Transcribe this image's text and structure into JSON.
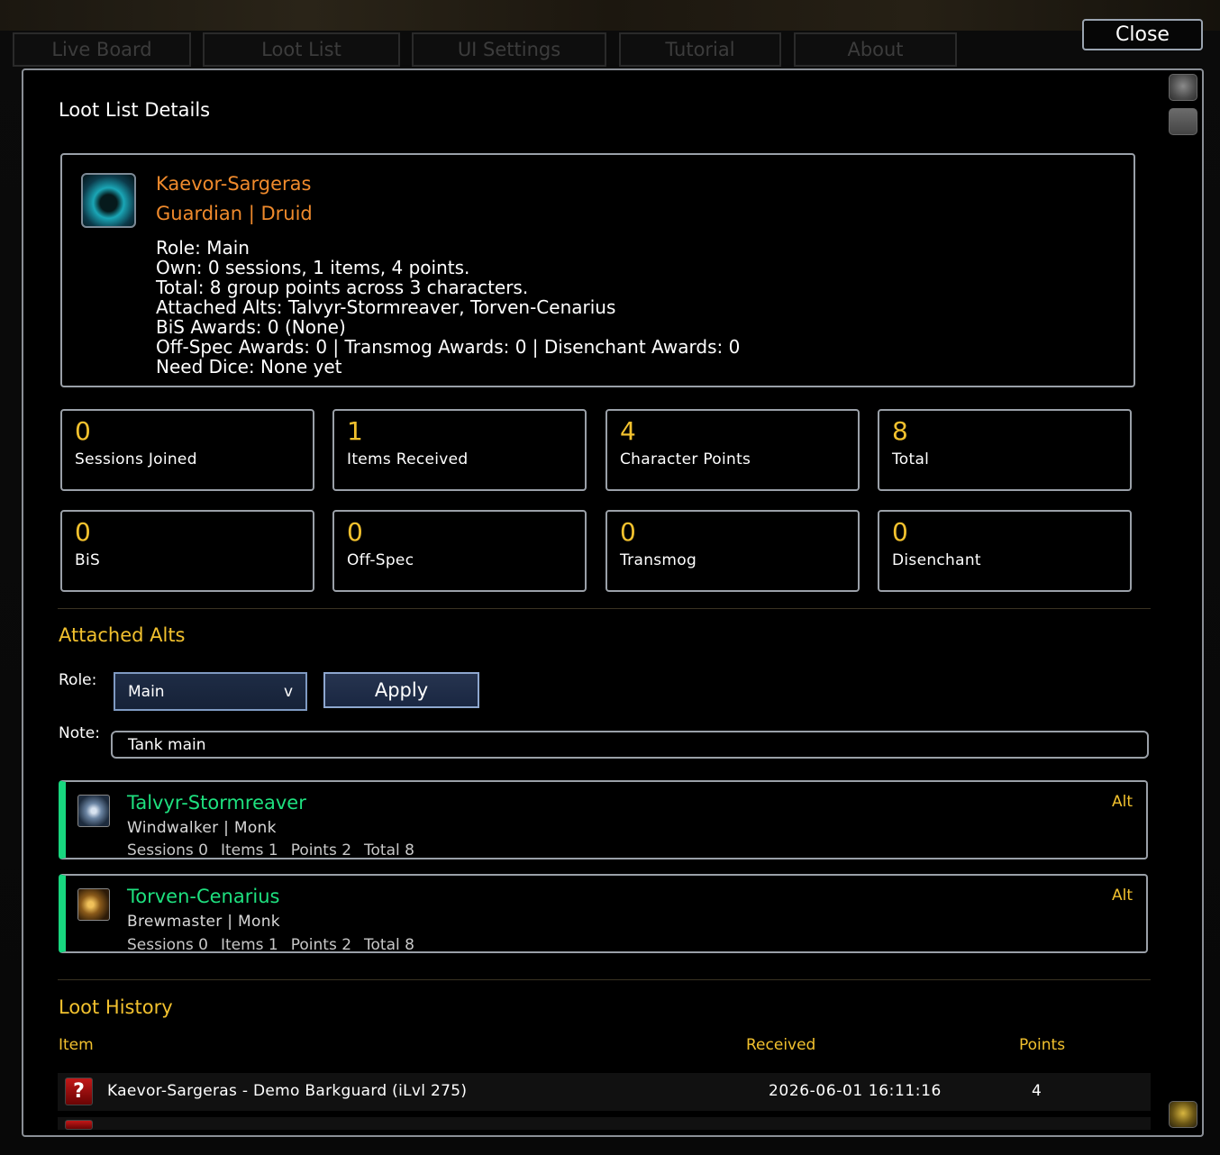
{
  "window": {
    "tabs": [
      {
        "label": "Live Board"
      },
      {
        "label": "Loot List"
      },
      {
        "label": "UI Settings"
      },
      {
        "label": "Tutorial"
      },
      {
        "label": "About"
      }
    ],
    "close_label": "Close"
  },
  "panel": {
    "title": "Loot List Details"
  },
  "profile": {
    "icon": "paw-icon",
    "name": "Kaevor-Sargeras",
    "spec_class": "Guardian | Druid",
    "lines": [
      "Role: Main",
      "Own: 0 sessions, 1 items, 4 points.",
      "Total: 8 group points across 3 characters.",
      "Attached Alts: Talvyr-Stormreaver, Torven-Cenarius",
      "BiS Awards: 0 (None)",
      "Off-Spec Awards: 0 | Transmog Awards: 0 | Disenchant Awards: 0",
      "Need Dice: None yet"
    ]
  },
  "stats": [
    {
      "value": "0",
      "label": "Sessions Joined"
    },
    {
      "value": "1",
      "label": "Items Received"
    },
    {
      "value": "4",
      "label": "Character Points"
    },
    {
      "value": "8",
      "label": "Total"
    },
    {
      "value": "0",
      "label": "BiS"
    },
    {
      "value": "0",
      "label": "Off-Spec"
    },
    {
      "value": "0",
      "label": "Transmog"
    },
    {
      "value": "0",
      "label": "Disenchant"
    }
  ],
  "alts_section": {
    "title": "Attached Alts",
    "role_label": "Role:",
    "role_value": "Main",
    "role_arrow": "v",
    "apply_label": "Apply",
    "note_label": "Note:",
    "note_value": "Tank main",
    "alts": [
      {
        "name": "Talvyr-Stormreaver",
        "spec_class": "Windwalker | Monk",
        "sessions": "Sessions 0",
        "items": "Items 1",
        "points": "Points 2",
        "total": "Total 8",
        "role": "Alt"
      },
      {
        "name": "Torven-Cenarius",
        "spec_class": "Brewmaster | Monk",
        "sessions": "Sessions 0",
        "items": "Items 1",
        "points": "Points 2",
        "total": "Total 8",
        "role": "Alt"
      }
    ]
  },
  "loot_history": {
    "title": "Loot History",
    "columns": {
      "item": "Item",
      "received": "Received",
      "points": "Points"
    },
    "rows": [
      {
        "icon": "question-mark-icon",
        "glyph": "?",
        "item": "Kaevor-Sargeras - Demo Barkguard (iLvl 275)",
        "received": "2026-06-01 16:11:16",
        "points": "4"
      }
    ]
  },
  "colors": {
    "class_druid": "#ef8a2c",
    "class_monk": "#1ee07f",
    "accent_gold": "#f2c12e",
    "border": "#9aa0a8"
  }
}
